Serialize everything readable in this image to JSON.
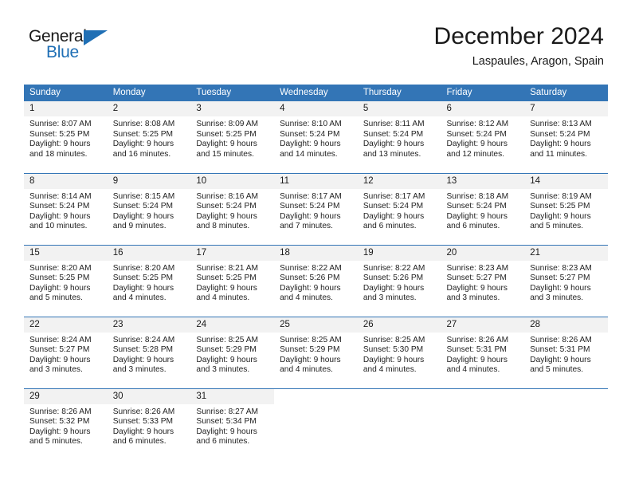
{
  "brand": {
    "name_part1": "General",
    "name_part2": "Blue",
    "accent_color": "#1f6fb5"
  },
  "header": {
    "title": "December 2024",
    "location": "Laspaules, Aragon, Spain"
  },
  "calendar": {
    "header_bg": "#3375b6",
    "daynum_bg": "#f2f2f2",
    "weekday_headers": [
      "Sunday",
      "Monday",
      "Tuesday",
      "Wednesday",
      "Thursday",
      "Friday",
      "Saturday"
    ],
    "weeks": [
      [
        {
          "day": "1",
          "sunrise": "Sunrise: 8:07 AM",
          "sunset": "Sunset: 5:25 PM",
          "daylight_line1": "Daylight: 9 hours",
          "daylight_line2": "and 18 minutes."
        },
        {
          "day": "2",
          "sunrise": "Sunrise: 8:08 AM",
          "sunset": "Sunset: 5:25 PM",
          "daylight_line1": "Daylight: 9 hours",
          "daylight_line2": "and 16 minutes."
        },
        {
          "day": "3",
          "sunrise": "Sunrise: 8:09 AM",
          "sunset": "Sunset: 5:25 PM",
          "daylight_line1": "Daylight: 9 hours",
          "daylight_line2": "and 15 minutes."
        },
        {
          "day": "4",
          "sunrise": "Sunrise: 8:10 AM",
          "sunset": "Sunset: 5:24 PM",
          "daylight_line1": "Daylight: 9 hours",
          "daylight_line2": "and 14 minutes."
        },
        {
          "day": "5",
          "sunrise": "Sunrise: 8:11 AM",
          "sunset": "Sunset: 5:24 PM",
          "daylight_line1": "Daylight: 9 hours",
          "daylight_line2": "and 13 minutes."
        },
        {
          "day": "6",
          "sunrise": "Sunrise: 8:12 AM",
          "sunset": "Sunset: 5:24 PM",
          "daylight_line1": "Daylight: 9 hours",
          "daylight_line2": "and 12 minutes."
        },
        {
          "day": "7",
          "sunrise": "Sunrise: 8:13 AM",
          "sunset": "Sunset: 5:24 PM",
          "daylight_line1": "Daylight: 9 hours",
          "daylight_line2": "and 11 minutes."
        }
      ],
      [
        {
          "day": "8",
          "sunrise": "Sunrise: 8:14 AM",
          "sunset": "Sunset: 5:24 PM",
          "daylight_line1": "Daylight: 9 hours",
          "daylight_line2": "and 10 minutes."
        },
        {
          "day": "9",
          "sunrise": "Sunrise: 8:15 AM",
          "sunset": "Sunset: 5:24 PM",
          "daylight_line1": "Daylight: 9 hours",
          "daylight_line2": "and 9 minutes."
        },
        {
          "day": "10",
          "sunrise": "Sunrise: 8:16 AM",
          "sunset": "Sunset: 5:24 PM",
          "daylight_line1": "Daylight: 9 hours",
          "daylight_line2": "and 8 minutes."
        },
        {
          "day": "11",
          "sunrise": "Sunrise: 8:17 AM",
          "sunset": "Sunset: 5:24 PM",
          "daylight_line1": "Daylight: 9 hours",
          "daylight_line2": "and 7 minutes."
        },
        {
          "day": "12",
          "sunrise": "Sunrise: 8:17 AM",
          "sunset": "Sunset: 5:24 PM",
          "daylight_line1": "Daylight: 9 hours",
          "daylight_line2": "and 6 minutes."
        },
        {
          "day": "13",
          "sunrise": "Sunrise: 8:18 AM",
          "sunset": "Sunset: 5:24 PM",
          "daylight_line1": "Daylight: 9 hours",
          "daylight_line2": "and 6 minutes."
        },
        {
          "day": "14",
          "sunrise": "Sunrise: 8:19 AM",
          "sunset": "Sunset: 5:25 PM",
          "daylight_line1": "Daylight: 9 hours",
          "daylight_line2": "and 5 minutes."
        }
      ],
      [
        {
          "day": "15",
          "sunrise": "Sunrise: 8:20 AM",
          "sunset": "Sunset: 5:25 PM",
          "daylight_line1": "Daylight: 9 hours",
          "daylight_line2": "and 5 minutes."
        },
        {
          "day": "16",
          "sunrise": "Sunrise: 8:20 AM",
          "sunset": "Sunset: 5:25 PM",
          "daylight_line1": "Daylight: 9 hours",
          "daylight_line2": "and 4 minutes."
        },
        {
          "day": "17",
          "sunrise": "Sunrise: 8:21 AM",
          "sunset": "Sunset: 5:25 PM",
          "daylight_line1": "Daylight: 9 hours",
          "daylight_line2": "and 4 minutes."
        },
        {
          "day": "18",
          "sunrise": "Sunrise: 8:22 AM",
          "sunset": "Sunset: 5:26 PM",
          "daylight_line1": "Daylight: 9 hours",
          "daylight_line2": "and 4 minutes."
        },
        {
          "day": "19",
          "sunrise": "Sunrise: 8:22 AM",
          "sunset": "Sunset: 5:26 PM",
          "daylight_line1": "Daylight: 9 hours",
          "daylight_line2": "and 3 minutes."
        },
        {
          "day": "20",
          "sunrise": "Sunrise: 8:23 AM",
          "sunset": "Sunset: 5:27 PM",
          "daylight_line1": "Daylight: 9 hours",
          "daylight_line2": "and 3 minutes."
        },
        {
          "day": "21",
          "sunrise": "Sunrise: 8:23 AM",
          "sunset": "Sunset: 5:27 PM",
          "daylight_line1": "Daylight: 9 hours",
          "daylight_line2": "and 3 minutes."
        }
      ],
      [
        {
          "day": "22",
          "sunrise": "Sunrise: 8:24 AM",
          "sunset": "Sunset: 5:27 PM",
          "daylight_line1": "Daylight: 9 hours",
          "daylight_line2": "and 3 minutes."
        },
        {
          "day": "23",
          "sunrise": "Sunrise: 8:24 AM",
          "sunset": "Sunset: 5:28 PM",
          "daylight_line1": "Daylight: 9 hours",
          "daylight_line2": "and 3 minutes."
        },
        {
          "day": "24",
          "sunrise": "Sunrise: 8:25 AM",
          "sunset": "Sunset: 5:29 PM",
          "daylight_line1": "Daylight: 9 hours",
          "daylight_line2": "and 3 minutes."
        },
        {
          "day": "25",
          "sunrise": "Sunrise: 8:25 AM",
          "sunset": "Sunset: 5:29 PM",
          "daylight_line1": "Daylight: 9 hours",
          "daylight_line2": "and 4 minutes."
        },
        {
          "day": "26",
          "sunrise": "Sunrise: 8:25 AM",
          "sunset": "Sunset: 5:30 PM",
          "daylight_line1": "Daylight: 9 hours",
          "daylight_line2": "and 4 minutes."
        },
        {
          "day": "27",
          "sunrise": "Sunrise: 8:26 AM",
          "sunset": "Sunset: 5:31 PM",
          "daylight_line1": "Daylight: 9 hours",
          "daylight_line2": "and 4 minutes."
        },
        {
          "day": "28",
          "sunrise": "Sunrise: 8:26 AM",
          "sunset": "Sunset: 5:31 PM",
          "daylight_line1": "Daylight: 9 hours",
          "daylight_line2": "and 5 minutes."
        }
      ],
      [
        {
          "day": "29",
          "sunrise": "Sunrise: 8:26 AM",
          "sunset": "Sunset: 5:32 PM",
          "daylight_line1": "Daylight: 9 hours",
          "daylight_line2": "and 5 minutes."
        },
        {
          "day": "30",
          "sunrise": "Sunrise: 8:26 AM",
          "sunset": "Sunset: 5:33 PM",
          "daylight_line1": "Daylight: 9 hours",
          "daylight_line2": "and 6 minutes."
        },
        {
          "day": "31",
          "sunrise": "Sunrise: 8:27 AM",
          "sunset": "Sunset: 5:34 PM",
          "daylight_line1": "Daylight: 9 hours",
          "daylight_line2": "and 6 minutes."
        },
        null,
        null,
        null,
        null
      ]
    ]
  }
}
